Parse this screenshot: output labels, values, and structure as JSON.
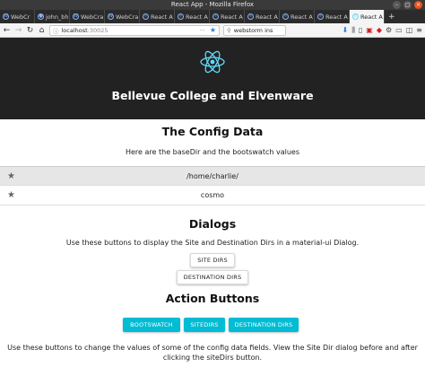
{
  "window": {
    "title": "React App - Mozilla Firefox"
  },
  "tabs": [
    {
      "label": "WebCr",
      "icon": "webstorm-favicon"
    },
    {
      "label": "john_bh",
      "icon": "github-favicon"
    },
    {
      "label": "WebCra",
      "icon": "webstorm-favicon"
    },
    {
      "label": "WebCra",
      "icon": "webstorm-favicon"
    },
    {
      "label": "React A",
      "icon": "react-favicon"
    },
    {
      "label": "React A",
      "icon": "react-favicon"
    },
    {
      "label": "React A",
      "icon": "react-favicon"
    },
    {
      "label": "React A",
      "icon": "react-favicon"
    },
    {
      "label": "React A",
      "icon": "react-favicon"
    },
    {
      "label": "React A",
      "icon": "react-favicon"
    },
    {
      "label": "React A",
      "icon": "react-favicon",
      "active": true
    }
  ],
  "navbar": {
    "url_host": "localhost",
    "url_port": ":30025",
    "search_text": "webstorm ins"
  },
  "header": {
    "title": "Bellevue College and Elvenware"
  },
  "config": {
    "heading": "The Config Data",
    "description": "Here are the baseDir and the bootswatch values",
    "base_dir": "/home/charlie/",
    "bootswatch": "cosmo"
  },
  "dialogs": {
    "heading": "Dialogs",
    "description": "Use these buttons to display the Site and Destination Dirs in a material-ui Dialog.",
    "site_dirs_label": "SITE DIRS",
    "destination_dirs_label": "DESTINATION DIRS"
  },
  "actions": {
    "heading": "Action Buttons",
    "bootswatch_label": "BOOTSWATCH",
    "sitedirs_label": "SITEDIRS",
    "destination_dirs_label": "DESTINATION DIRS",
    "footer_text": "Use these buttons to change the values of some of the config data fields. View the Site Dir dialog before and after clicking the siteDirs button."
  },
  "colors": {
    "header_bg": "#222222",
    "accent_cyan": "#00bcd4",
    "react_logo": "#61dafb"
  }
}
